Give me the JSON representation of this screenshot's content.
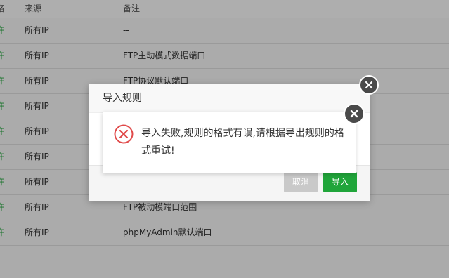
{
  "table": {
    "headers": {
      "strategy": "略",
      "source": "来源",
      "note": "备注"
    },
    "rows": [
      {
        "strategy": "许",
        "source": "所有IP",
        "note": "--"
      },
      {
        "strategy": "许",
        "source": "所有IP",
        "note": "FTP主动模式数据端口"
      },
      {
        "strategy": "许",
        "source": "所有IP",
        "note": "FTP协议默认端口"
      },
      {
        "strategy": "许",
        "source": "所有IP",
        "note": ""
      },
      {
        "strategy": "许",
        "source": "所有IP",
        "note": ""
      },
      {
        "strategy": "许",
        "source": "所有IP",
        "note": ""
      },
      {
        "strategy": "许",
        "source": "所有IP",
        "note": ""
      },
      {
        "strategy": "许",
        "source": "所有IP",
        "note": "FTP被动模端口范围"
      },
      {
        "strategy": "许",
        "source": "所有IP",
        "note": "phpMyAdmin默认端口"
      }
    ]
  },
  "import_dialog": {
    "title": "导入规则",
    "cancel_label": "取消",
    "import_label": "导入"
  },
  "error_toast": {
    "message": "导入失败,规则的格式有误,请根据导出规则的格式重试!"
  },
  "colors": {
    "accent": "#20a53a",
    "error": "#e04a4a",
    "close_button": "#4a4a4a",
    "cancel_button": "#c9c9c9"
  },
  "icons": {
    "dialog_close": "close-icon",
    "toast_close": "close-icon",
    "error": "error-x-icon"
  }
}
